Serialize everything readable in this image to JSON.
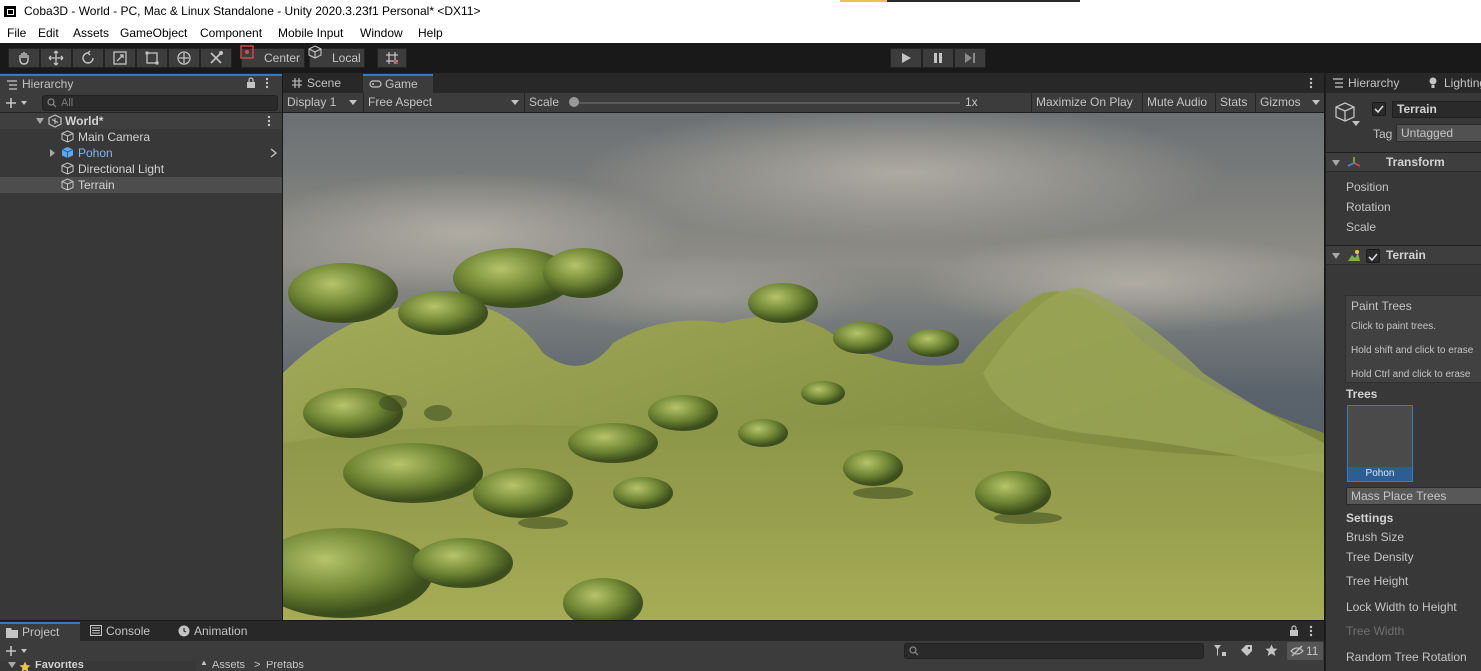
{
  "window": {
    "title": "Coba3D - World - PC, Mac & Linux Standalone - Unity 2020.3.23f1 Personal* <DX11>"
  },
  "menu": [
    "File",
    "Edit",
    "Assets",
    "GameObject",
    "Component",
    "Mobile Input",
    "Window",
    "Help"
  ],
  "toolbar": {
    "pivot_mode": "Center",
    "pivot_rotation": "Local"
  },
  "hierarchy": {
    "tab_label": "Hierarchy",
    "search_placeholder": "All",
    "scene_name": "World*",
    "items": [
      {
        "label": "Main Camera",
        "color": "#d2d2d2"
      },
      {
        "label": "Pohon",
        "color": "#7cb4f5"
      },
      {
        "label": "Directional Light",
        "color": "#d2d2d2"
      },
      {
        "label": "Terrain",
        "color": "#d2d2d2"
      }
    ]
  },
  "game_view": {
    "tabs": {
      "scene": "Scene",
      "game": "Game"
    },
    "display": "Display 1",
    "aspect": "Free Aspect",
    "scale_label": "Scale",
    "scale_value": "1x",
    "scale_fraction": 0.0,
    "buttons": {
      "maximize": "Maximize On Play",
      "mute": "Mute Audio",
      "stats": "Stats",
      "gizmos": "Gizmos"
    }
  },
  "inspector": {
    "tabs": {
      "hierarchy": "Hierarchy",
      "lighting": "Lighting"
    },
    "object_name": "Terrain",
    "tag_label": "Tag",
    "tag_value": "Untagged",
    "transform": {
      "header": "Transform",
      "position": "Position",
      "rotation": "Rotation",
      "scale": "Scale"
    },
    "terrain": {
      "header": "Terrain",
      "paint_trees_title": "Paint Trees",
      "help_lines": [
        "Click to paint trees.",
        "Hold shift and click to erase",
        "Hold Ctrl and click to erase"
      ],
      "trees_label": "Trees",
      "tree_prototype": "Pohon",
      "mass_place": "Mass Place Trees",
      "settings_label": "Settings",
      "settings": {
        "brush_size": "Brush Size",
        "tree_density": "Tree Density",
        "tree_height": "Tree Height",
        "lock_width": "Lock Width to Height",
        "tree_width": "Tree Width",
        "random_rotation": "Random Tree Rotation"
      }
    }
  },
  "project": {
    "tabs": {
      "project": "Project",
      "console": "Console",
      "animation": "Animation"
    },
    "favorites": "Favorites",
    "breadcrumb": [
      "Assets",
      "Prefabs"
    ],
    "hidden_count": "11"
  },
  "colors": {
    "accent_blue": "#3a79bb",
    "panel": "#383838",
    "tabbar": "#282828"
  }
}
